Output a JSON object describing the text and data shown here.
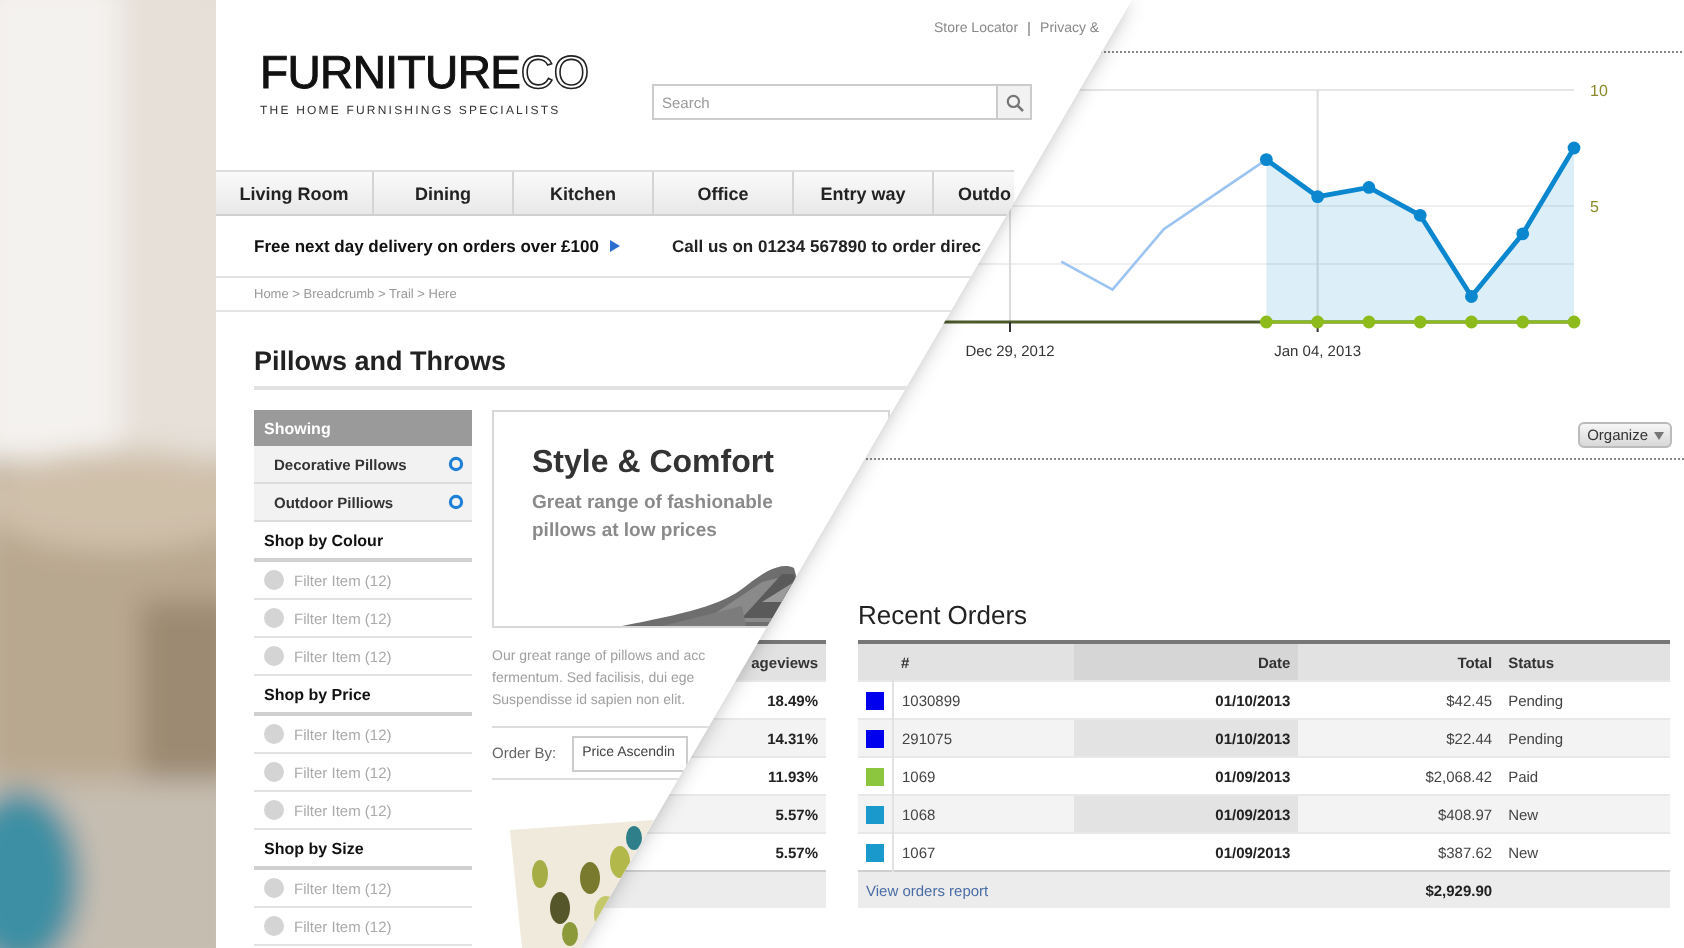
{
  "store": {
    "top_links": [
      "Store Locator",
      "Privacy &"
    ],
    "logo": {
      "wordmark": "FURNITURE",
      "wordmark_outline": "CO",
      "tagline": "THE HOME FURNISHINGS SPECIALISTS"
    },
    "search": {
      "placeholder": "Search"
    },
    "nav": [
      "Living Room",
      "Dining",
      "Kitchen",
      "Office",
      "Entry way",
      "Outdo"
    ],
    "promo": [
      {
        "kind": "link",
        "text": "Free next day delivery on orders over £100"
      },
      {
        "kind": "text",
        "text": "Call us on 01234 567890 to order direc"
      }
    ],
    "breadcrumb": "Home > Breadcrumb > Trail > Here",
    "title": "Pillows and Throws",
    "showing": {
      "title": "Showing",
      "items": [
        "Decorative Pillows",
        "Outdoor Pilliows"
      ]
    },
    "filter_groups": [
      {
        "title": "Shop by Colour",
        "items": [
          "Filter Item (12)",
          "Filter Item (12)",
          "Filter Item (12)"
        ]
      },
      {
        "title": "Shop by Price",
        "items": [
          "Filter Item (12)",
          "Filter Item (12)",
          "Filter Item (12)"
        ]
      },
      {
        "title": "Shop by Size",
        "items": [
          "Filter Item (12)",
          "Filter Item (12)"
        ]
      }
    ],
    "banner": {
      "title": "Style & Comfort",
      "subtitle": "Great range of fashionable pillows at low prices"
    },
    "intro_lines": [
      "Our great range of pillows and acc",
      "fermentum. Sed facilisis, dui ege",
      "Suspendisse id sapien non elit."
    ],
    "order_by": {
      "label": "Order By:",
      "value": "Price Ascendin"
    }
  },
  "dashboard": {
    "chart": {
      "chart_data": {
        "type": "line",
        "categories": [
          "Dec 29, 2012",
          null,
          null,
          null,
          null,
          null,
          "Jan 04, 2013",
          null,
          null,
          null,
          null,
          null
        ],
        "ylim": [
          0,
          10
        ],
        "yticks": [
          {
            "value": 5,
            "label": "5"
          },
          {
            "value": 10,
            "label": "10"
          }
        ],
        "series": [
          {
            "color": "#9cc4f2",
            "marker": false,
            "values": [
              null,
              2.6,
              1.4,
              4.0,
              5.5,
              7.0,
              null,
              null,
              null,
              null,
              null,
              null
            ]
          },
          {
            "color": "#0a87cf",
            "marker": true,
            "values": [
              null,
              null,
              null,
              null,
              null,
              7.0,
              5.4,
              5.8,
              4.6,
              1.1,
              3.8,
              7.5
            ]
          },
          {
            "color": "#8dbb1c",
            "marker": true,
            "values": [
              null,
              null,
              null,
              null,
              null,
              0,
              0,
              0,
              0,
              0,
              0,
              0
            ]
          }
        ]
      }
    },
    "organize_button": "Organize",
    "pageviews_table": {
      "column": "ageviews",
      "values": [
        "18.49%",
        "14.31%",
        "11.93%",
        "5.57%",
        "5.57%"
      ]
    },
    "orders": {
      "title": "Recent Orders",
      "columns": [
        "#",
        "Date",
        "Total",
        "Status"
      ],
      "rows": [
        {
          "color": "#0000ee",
          "number": "1030899",
          "date": "01/10/2013",
          "total": "$42.45",
          "status": "Pending"
        },
        {
          "color": "#0000ee",
          "number": "291075",
          "date": "01/10/2013",
          "total": "$22.44",
          "status": "Pending"
        },
        {
          "color": "#8cc63f",
          "number": "1069",
          "date": "01/09/2013",
          "total": "$2,068.42",
          "status": "Paid"
        },
        {
          "color": "#1a99cc",
          "number": "1068",
          "date": "01/09/2013",
          "total": "$408.97",
          "status": "New"
        },
        {
          "color": "#1a99cc",
          "number": "1067",
          "date": "01/09/2013",
          "total": "$387.62",
          "status": "New"
        }
      ],
      "footer": {
        "link": "View orders report",
        "total": "$2,929.90"
      }
    }
  }
}
